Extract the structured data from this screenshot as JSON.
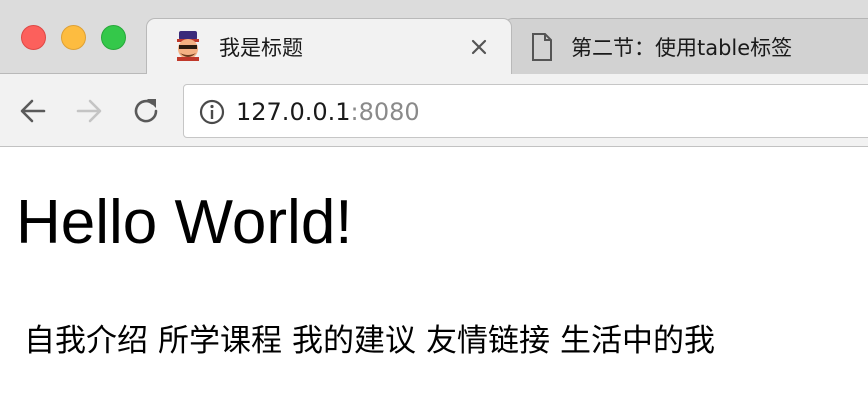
{
  "window": {
    "traffic_lights": [
      "close",
      "minimize",
      "zoom"
    ]
  },
  "tabs": [
    {
      "title": "我是标题",
      "icon": "cartoon-face-favicon",
      "active": true
    },
    {
      "title": "第二节：使用table标签",
      "icon": "document-icon",
      "active": false
    }
  ],
  "toolbar": {
    "back_icon": "arrow-left-icon",
    "forward_icon": "arrow-right-icon",
    "reload_icon": "reload-icon",
    "address": {
      "info_icon": "info-icon",
      "host": "127.0.0.1",
      "port": ":8080"
    }
  },
  "page": {
    "heading": "Hello World!",
    "nav_links": [
      "自我介绍",
      "所学课程",
      "我的建议",
      "友情链接",
      "生活中的我"
    ]
  },
  "colors": {
    "tabstrip_bg": "#dcdcdc",
    "toolbar_bg": "#f2f2f2",
    "traffic_close": "#fc605c",
    "traffic_minimize": "#fdbc40",
    "traffic_zoom": "#34c84a",
    "url_port": "#8a8a8a"
  }
}
